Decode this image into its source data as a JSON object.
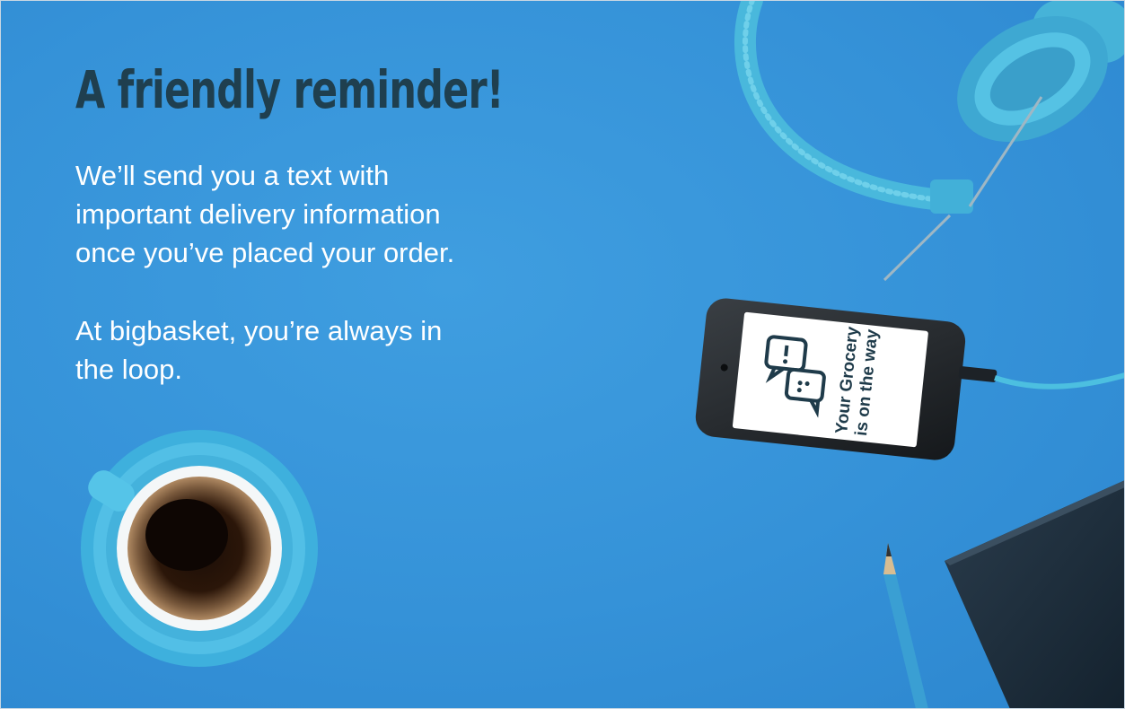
{
  "banner": {
    "headline": "A friendly reminder!",
    "paragraph_1": "We’ll send you a text with\nimportant delivery information\nonce you’ve placed your order.",
    "paragraph_2": "At bigbasket, you’re always in\nthe loop."
  },
  "phone": {
    "screen_line_1": "Your Grocery",
    "screen_line_2": "is on the way"
  },
  "icons": {
    "phone_screen_icon": "chat-bubbles-icon"
  },
  "colors": {
    "background": "#3592d8",
    "headline": "#1f3f4f",
    "body_text": "#ffffff",
    "accent_turquoise": "#4cbfe0"
  }
}
